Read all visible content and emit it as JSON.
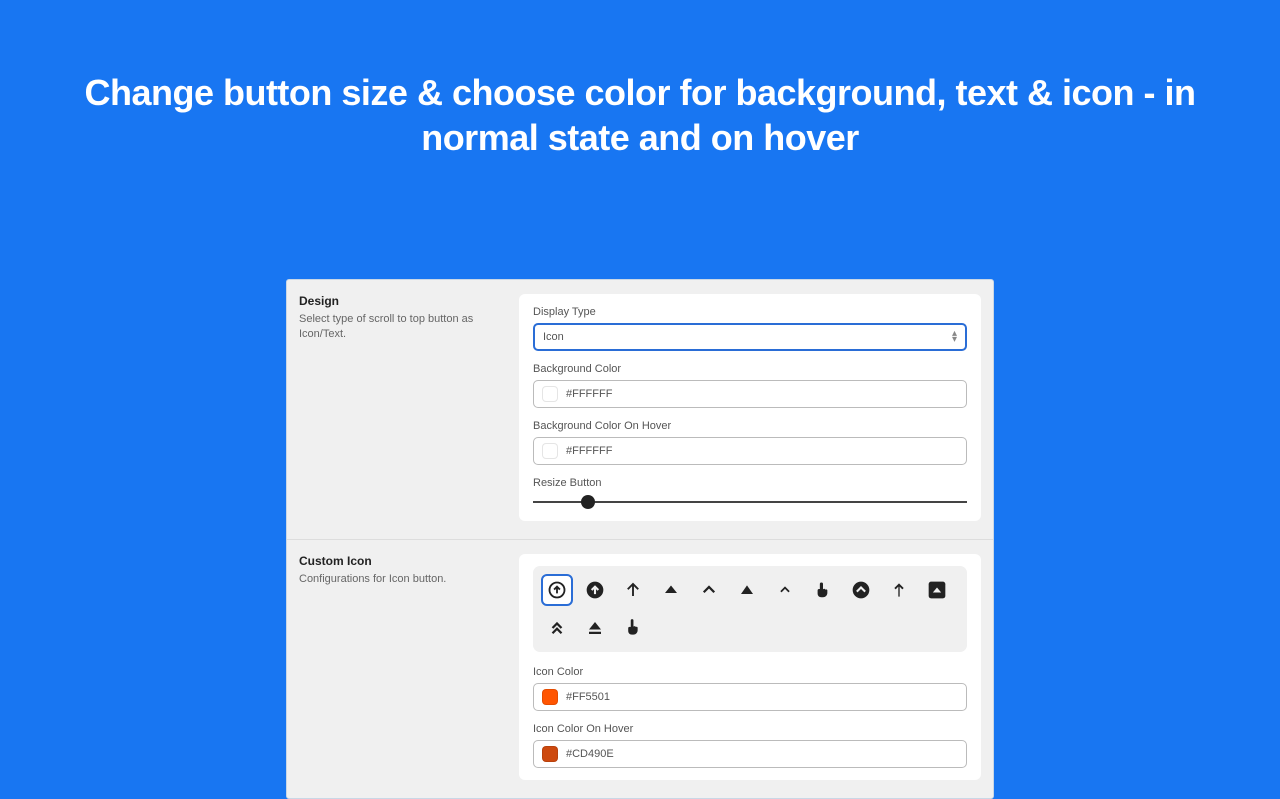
{
  "hero": {
    "title": "Change button size & choose color for background, text & icon - in normal state and on hover"
  },
  "design": {
    "heading": "Design",
    "description": "Select type of scroll to top button as Icon/Text.",
    "display_type_label": "Display Type",
    "display_type_value": "Icon",
    "bg_color_label": "Background Color",
    "bg_color_value": "#FFFFFF",
    "bg_hover_label": "Background Color On Hover",
    "bg_hover_value": "#FFFFFF",
    "resize_label": "Resize Button"
  },
  "custom_icon": {
    "heading": "Custom Icon",
    "description": "Configurations for Icon button.",
    "icon_color_label": "Icon Color",
    "icon_color_value": "#FF5501",
    "icon_hover_label": "Icon Color On Hover",
    "icon_hover_value": "#CD490E",
    "icons": [
      "circle-arrow-up-outline",
      "circle-arrow-up-solid",
      "arrow-up-thin",
      "caret-up-solid",
      "chevron-up",
      "triangle-up",
      "chevron-up-small",
      "hand-point-up",
      "chevron-circle-up",
      "arrow-up-narrow",
      "square-caret-up",
      "double-chevron-up",
      "eject",
      "hand-pointer"
    ],
    "selected_icon_index": 0
  },
  "colors": {
    "white": "#FFFFFF",
    "icon": "#FF5501",
    "icon_hover": "#CD490E"
  }
}
